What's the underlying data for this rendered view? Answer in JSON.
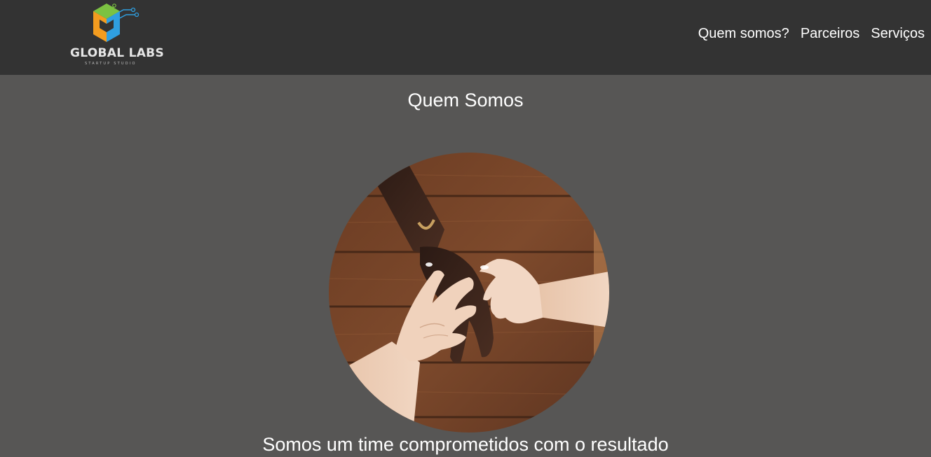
{
  "header": {
    "logo": {
      "name": "GLOBAL LABS",
      "tagline": "STARTUP STUDIO"
    },
    "nav": {
      "items": [
        {
          "label": "Quem somos?"
        },
        {
          "label": "Parceiros"
        },
        {
          "label": "Serviços"
        }
      ]
    }
  },
  "main": {
    "section_title": "Quem Somos",
    "image": {
      "alt": "Mãos unidas sobre uma mesa de madeira"
    },
    "tagline": "Somos um time comprometidos com o resultado"
  },
  "colors": {
    "header_bg": "#333333",
    "page_bg": "#575655",
    "text": "#ffffff",
    "logo_green": "#7cc242",
    "logo_orange": "#f39c1f",
    "logo_blue": "#2f9fe0"
  }
}
